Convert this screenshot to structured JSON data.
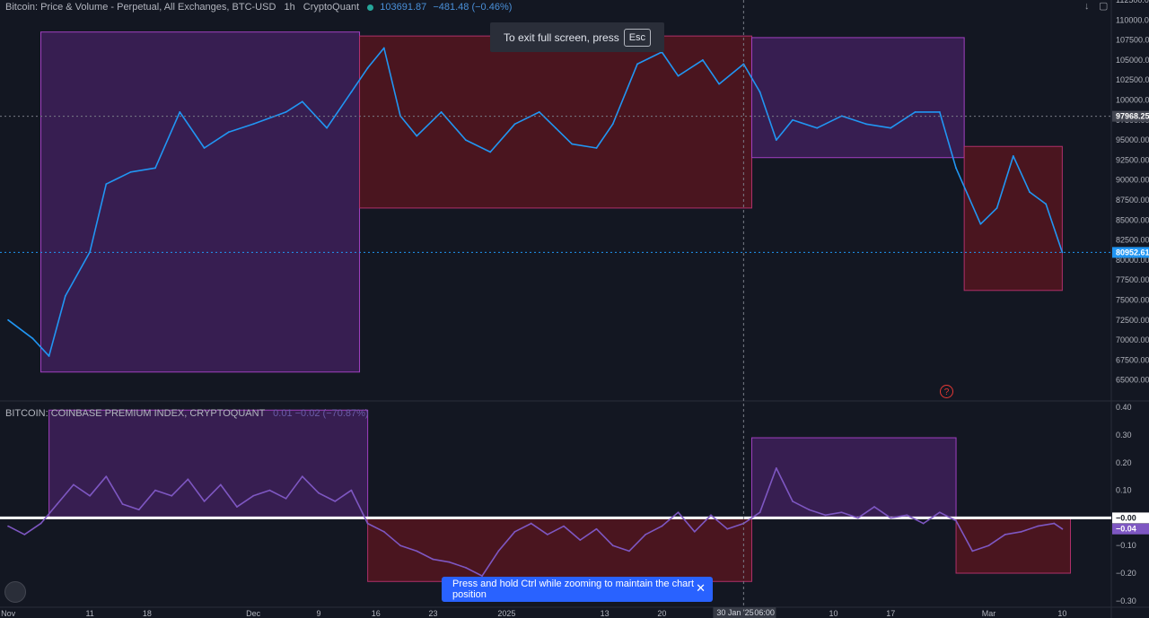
{
  "header": {
    "title": "Bitcoin: Price & Volume - Perpetual, All Exchanges, BTC-USD",
    "timeframe": "1h",
    "source": "CryptoQuant",
    "last_price": "103691.87",
    "change": "−481.48 (−0.46%)"
  },
  "indicator_legend": {
    "title": "BITCOIN: COINBASE PREMIUM INDEX, CRYPTOQUANT",
    "values": "0.01 −0.02 (−70.87%)"
  },
  "toast_top": {
    "text": "To exit full screen, press",
    "key": "Esc"
  },
  "toast_bottom": {
    "text": "Press and hold Ctrl while zooming to maintain the chart position",
    "close": "✕"
  },
  "toolbar": {
    "down_icon": "↓",
    "fullscreen_icon": "▢"
  },
  "colors": {
    "background": "#131722",
    "price_line": "#2196f3",
    "premium_line": "#7e57c2",
    "box_purple": "#6a2c8a",
    "box_red": "#6b1c2a",
    "zero_line": "#ffffff"
  },
  "chart_data": [
    {
      "type": "line",
      "series": [
        {
          "name": "",
          "values_key": "price",
          "x": [
            "2024-11-01",
            "2024-11-04",
            "2024-11-06",
            "2024-11-08",
            "2024-11-11",
            "2024-11-13",
            "2024-11-16",
            "2024-11-19",
            "2024-11-22",
            "2024-11-25",
            "2024-11-28",
            "2024-12-01",
            "2024-12-05",
            "2024-12-07",
            "2024-12-10",
            "2024-12-13",
            "2024-12-15",
            "2024-12-17",
            "2024-12-19",
            "2024-12-21",
            "2024-12-24",
            "2024-12-27",
            "2024-12-30",
            "2025-01-02",
            "2025-01-05",
            "2025-01-07",
            "2025-01-09",
            "2025-01-12",
            "2025-01-14",
            "2025-01-17",
            "2025-01-20",
            "2025-01-22",
            "2025-01-25",
            "2025-01-27",
            "2025-01-30",
            "2025-02-01",
            "2025-02-03",
            "2025-02-05",
            "2025-02-08",
            "2025-02-11",
            "2025-02-14",
            "2025-02-17",
            "2025-02-20",
            "2025-02-23",
            "2025-02-25",
            "2025-02-28",
            "2025-03-02",
            "2025-03-04",
            "2025-03-06",
            "2025-03-08",
            "2025-03-10"
          ],
          "y": [
            72500,
            70200,
            68000,
            75500,
            81000,
            89500,
            91000,
            91500,
            98500,
            94000,
            96000,
            97000,
            98500,
            99800,
            96500,
            101000,
            104000,
            106500,
            98000,
            95500,
            98500,
            95000,
            93500,
            97000,
            98500,
            96500,
            94500,
            94000,
            97000,
            104500,
            106000,
            103000,
            105000,
            102000,
            104500,
            101000,
            95000,
            97500,
            96500,
            98000,
            97000,
            96500,
            98500,
            98500,
            91500,
            84500,
            86500,
            93000,
            88500,
            87000,
            80952
          ]
        }
      ],
      "ylim": [
        62500,
        112500
      ],
      "yticks": [
        "112500.00",
        "110000.00",
        "107500.00",
        "105000.00",
        "102500.00",
        "100000.00",
        "97500.00",
        "95000.00",
        "92500.00",
        "90000.00",
        "87500.00",
        "85000.00",
        "82500.00",
        "80000.00",
        "77500.00",
        "75000.00",
        "72500.00",
        "70000.00",
        "67500.00",
        "65000.00"
      ],
      "price_labels": [
        {
          "value": 97968.25,
          "label": "97968.25"
        },
        {
          "value": 80952.61,
          "label": "80952.61"
        }
      ],
      "boxes": [
        {
          "x0": "2024-11-05",
          "x1": "2024-12-14",
          "y0": 66000,
          "y1": 108500,
          "color": "purple"
        },
        {
          "x0": "2024-12-14",
          "x1": "2025-01-31",
          "y0": 86500,
          "y1": 108000,
          "color": "red"
        },
        {
          "x0": "2025-01-31",
          "x1": "2025-02-26",
          "y0": 92800,
          "y1": 107800,
          "color": "purple"
        },
        {
          "x0": "2025-02-26",
          "x1": "2025-03-10",
          "y0": 76200,
          "y1": 94200,
          "color": "red"
        }
      ]
    },
    {
      "type": "line",
      "series": [
        {
          "name": "",
          "x": [
            "2024-11-01",
            "2024-11-03",
            "2024-11-05",
            "2024-11-07",
            "2024-11-09",
            "2024-11-11",
            "2024-11-13",
            "2024-11-15",
            "2024-11-17",
            "2024-11-19",
            "2024-11-21",
            "2024-11-23",
            "2024-11-25",
            "2024-11-27",
            "2024-11-29",
            "2024-12-01",
            "2024-12-03",
            "2024-12-05",
            "2024-12-07",
            "2024-12-09",
            "2024-12-11",
            "2024-12-13",
            "2024-12-15",
            "2024-12-17",
            "2024-12-19",
            "2024-12-21",
            "2024-12-23",
            "2024-12-25",
            "2024-12-27",
            "2024-12-29",
            "2024-12-31",
            "2025-01-02",
            "2025-01-04",
            "2025-01-06",
            "2025-01-08",
            "2025-01-10",
            "2025-01-12",
            "2025-01-14",
            "2025-01-16",
            "2025-01-18",
            "2025-01-20",
            "2025-01-22",
            "2025-01-24",
            "2025-01-26",
            "2025-01-28",
            "2025-01-30",
            "2025-02-01",
            "2025-02-03",
            "2025-02-05",
            "2025-02-07",
            "2025-02-09",
            "2025-02-11",
            "2025-02-13",
            "2025-02-15",
            "2025-02-17",
            "2025-02-19",
            "2025-02-21",
            "2025-02-23",
            "2025-02-25",
            "2025-02-27",
            "2025-03-01",
            "2025-03-03",
            "2025-03-05",
            "2025-03-07",
            "2025-03-09",
            "2025-03-10"
          ],
          "y": [
            -0.03,
            -0.06,
            -0.02,
            0.05,
            0.12,
            0.08,
            0.15,
            0.05,
            0.03,
            0.1,
            0.08,
            0.14,
            0.06,
            0.12,
            0.04,
            0.08,
            0.1,
            0.07,
            0.15,
            0.09,
            0.06,
            0.1,
            -0.02,
            -0.05,
            -0.1,
            -0.12,
            -0.15,
            -0.16,
            -0.18,
            -0.21,
            -0.12,
            -0.05,
            -0.02,
            -0.06,
            -0.03,
            -0.08,
            -0.04,
            -0.1,
            -0.12,
            -0.06,
            -0.03,
            0.02,
            -0.05,
            0.01,
            -0.04,
            -0.02,
            0.02,
            0.18,
            0.06,
            0.03,
            0.01,
            0.02,
            0.0,
            0.04,
            0.0,
            0.01,
            -0.02,
            0.02,
            -0.01,
            -0.12,
            -0.1,
            -0.06,
            -0.05,
            -0.03,
            -0.02,
            -0.04
          ]
        }
      ],
      "ylim": [
        -0.32,
        0.42
      ],
      "yticks": [
        "0.40",
        "0.30",
        "0.20",
        "0.10",
        "−0.00",
        "−0.10",
        "−0.20",
        "−0.30"
      ],
      "value_labels": [
        {
          "value": 0.0,
          "label": "−0.00"
        },
        {
          "value": -0.04,
          "label": "−0.04"
        }
      ],
      "boxes": [
        {
          "x0": "2024-11-06",
          "x1": "2024-12-15",
          "y0": 0.0,
          "y1": 0.39,
          "color": "purple"
        },
        {
          "x0": "2024-12-15",
          "x1": "2025-01-31",
          "y0": -0.23,
          "y1": 0.0,
          "color": "red"
        },
        {
          "x0": "2025-01-31",
          "x1": "2025-02-25",
          "y0": 0.0,
          "y1": 0.29,
          "color": "purple"
        },
        {
          "x0": "2025-02-25",
          "x1": "2025-03-11",
          "y0": -0.2,
          "y1": 0.0,
          "color": "red"
        }
      ]
    }
  ],
  "xaxis": {
    "ticks": [
      {
        "date": "2024-11-01",
        "label": "Nov"
      },
      {
        "date": "2024-11-11",
        "label": "11"
      },
      {
        "date": "2024-11-18",
        "label": "18"
      },
      {
        "date": "2024-12-01",
        "label": "Dec"
      },
      {
        "date": "2024-12-09",
        "label": "9"
      },
      {
        "date": "2024-12-16",
        "label": "16"
      },
      {
        "date": "2024-12-23",
        "label": "23"
      },
      {
        "date": "2025-01-01",
        "label": "2025"
      },
      {
        "date": "2025-01-13",
        "label": "13"
      },
      {
        "date": "2025-01-20",
        "label": "20"
      },
      {
        "date": "2025-02-10",
        "label": "10"
      },
      {
        "date": "2025-02-17",
        "label": "17"
      },
      {
        "date": "2025-03-01",
        "label": "Mar"
      },
      {
        "date": "2025-03-10",
        "label": "10"
      }
    ],
    "crosshair": {
      "date": "2025-01-30",
      "label": "30 Jan '25",
      "time": "06:00"
    }
  }
}
